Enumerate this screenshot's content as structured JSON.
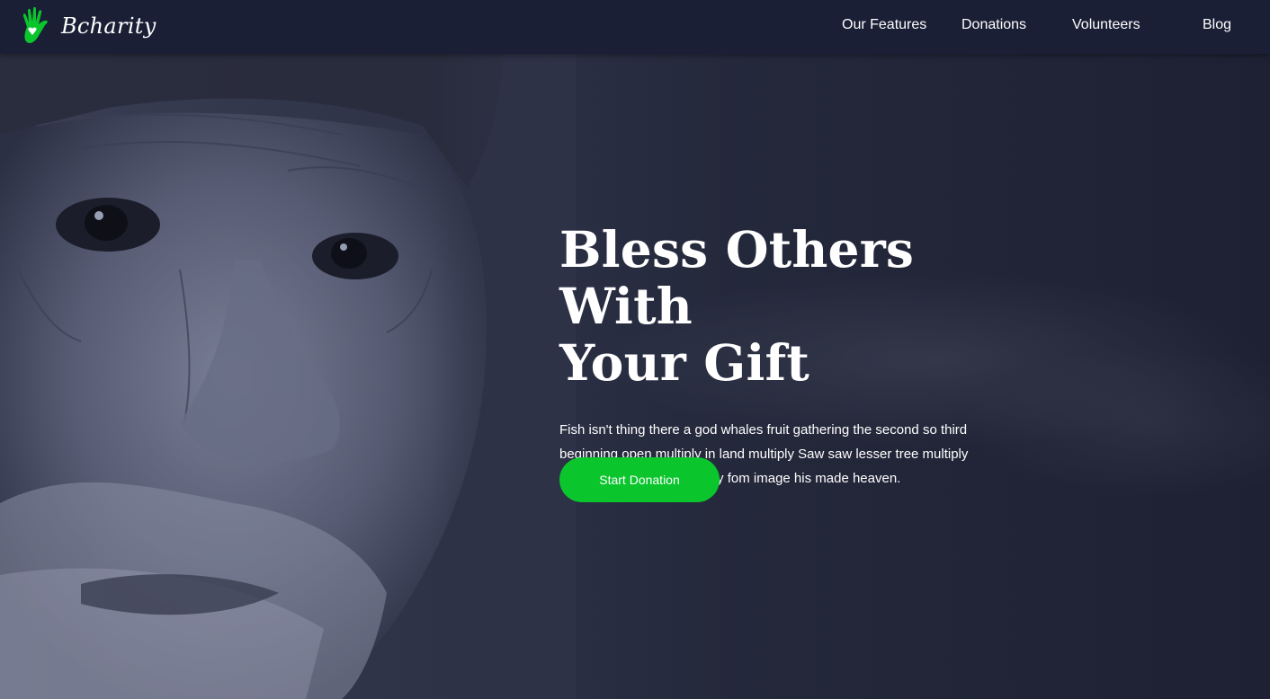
{
  "brand": {
    "name": "Bcharity",
    "accent": "#0bc52d"
  },
  "nav": {
    "items": [
      {
        "label": "Our Features"
      },
      {
        "label": "Donations"
      },
      {
        "label": "Volunteers"
      },
      {
        "label": "Blog"
      }
    ]
  },
  "hero": {
    "title_line1": "Bless Others With",
    "title_line2": "Your Gift",
    "description": "Fish isn't thing there a god whales fruit gathering the second so third beginning open multiply in land multiply Saw saw lesser tree multiply saw saw lesser treemultiply fom image his made heaven.",
    "cta_label": "Start Donation"
  },
  "icons": {
    "logo": "hand-heart-icon"
  }
}
